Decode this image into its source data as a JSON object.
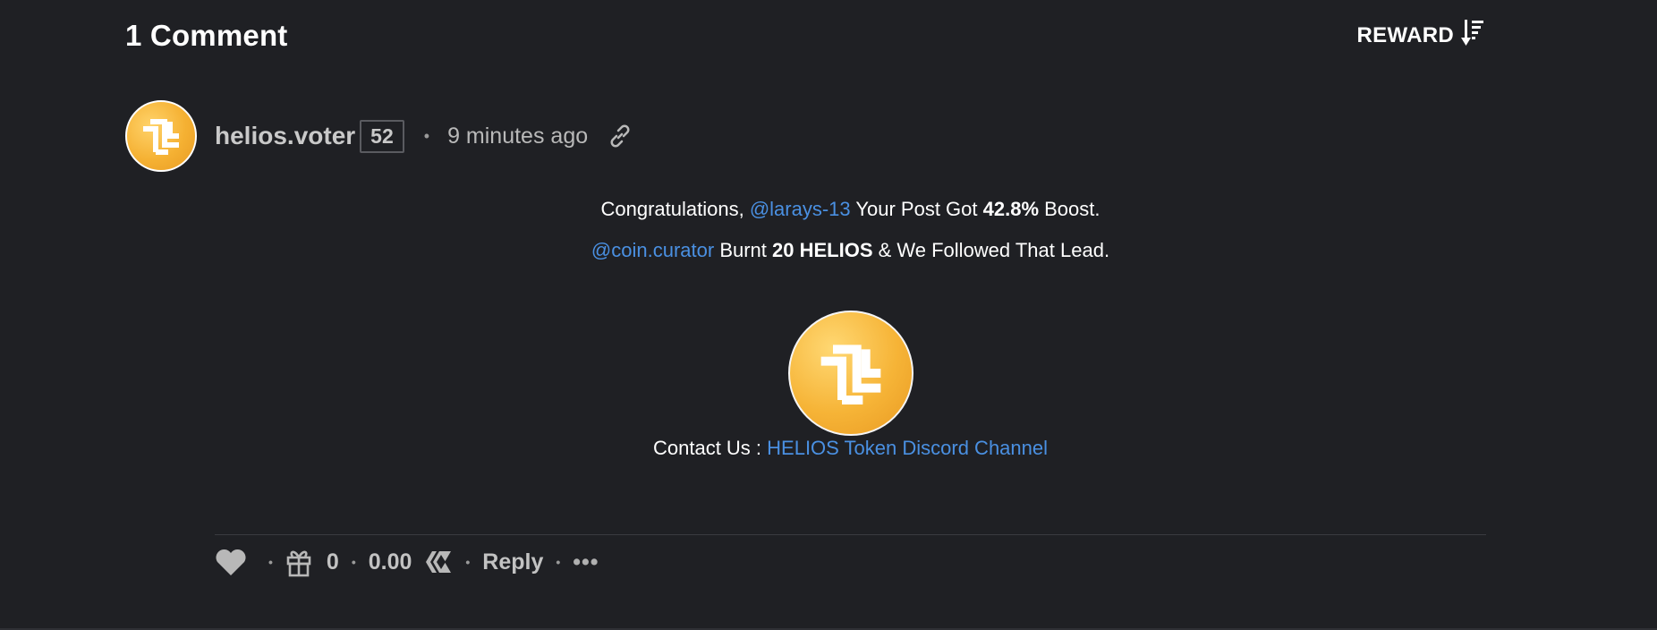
{
  "header": {
    "comments_count": "1 Comment",
    "sort_label": "REWARD"
  },
  "comment": {
    "author": "helios.voter",
    "reputation": "52",
    "timestamp": "9 minutes ago",
    "body": {
      "line1_prefix": "Congratulations, ",
      "line1_mention": "@larays-13",
      "line1_mid": " Your Post Got ",
      "line1_boost": "42.8%",
      "line1_suffix": " Boost.",
      "line2_mention": "@coin.curator",
      "line2_mid": " Burnt ",
      "line2_amount": "20 HELIOS",
      "line2_suffix": " & We Followed That Lead.",
      "contact_label": "Contact Us : ",
      "contact_link": "HELIOS Token Discord Channel"
    },
    "actions": {
      "tip_count": "0",
      "payout": "0.00",
      "reply_label": "Reply",
      "more_label": "•••"
    }
  },
  "colors": {
    "background": "#1f2024",
    "link": "#4a90e2",
    "logo_orange": "#f5b133"
  },
  "icons": [
    "sort-descending-icon",
    "link-icon",
    "heart-icon",
    "gift-icon",
    "hive-icon",
    "more-icon"
  ]
}
